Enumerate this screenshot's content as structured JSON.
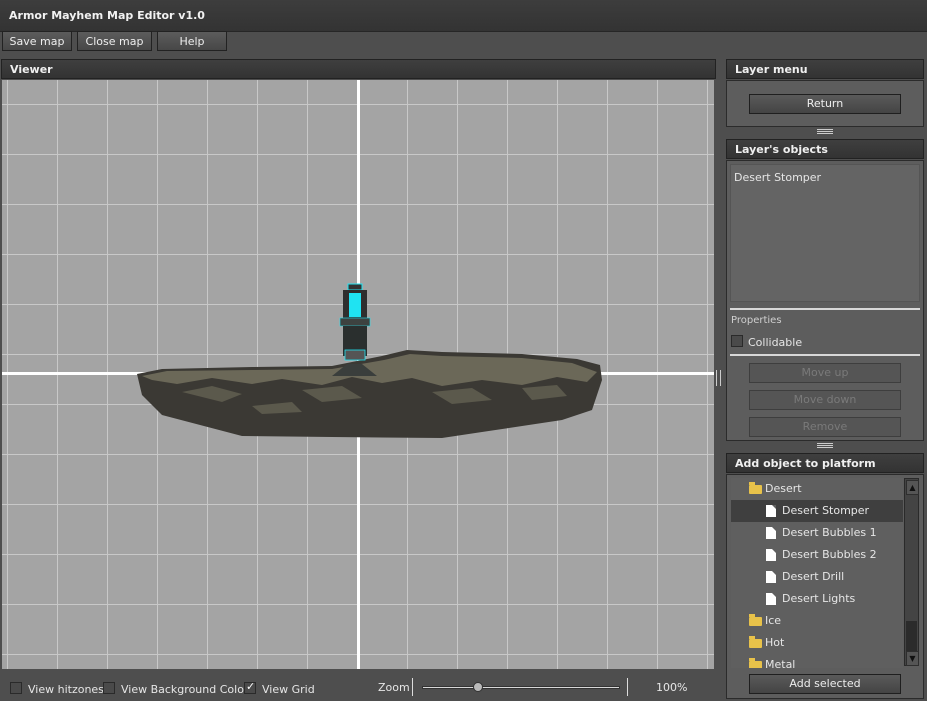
{
  "window": {
    "title": "Armor Mayhem Map Editor v1.0"
  },
  "toolbar": {
    "save_map": "Save map",
    "close_map": "Close map",
    "help": "Help"
  },
  "viewer": {
    "title": "Viewer"
  },
  "layer_menu": {
    "title": "Layer menu",
    "return_label": "Return"
  },
  "layer_objects": {
    "title": "Layer's objects",
    "items": [
      "Desert Stomper"
    ],
    "properties_label": "Properties",
    "collidable_label": "Collidable",
    "collidable_checked": false,
    "move_up_label": "Move up",
    "move_down_label": "Move down",
    "remove_label": "Remove"
  },
  "add_object": {
    "title": "Add object to platform",
    "tree": {
      "folders": [
        {
          "label": "Desert",
          "open": true
        },
        {
          "label": "Ice",
          "open": false
        },
        {
          "label": "Hot",
          "open": false
        },
        {
          "label": "Metal",
          "open": false
        }
      ],
      "desert_items": [
        "Desert Stomper",
        "Desert Bubbles 1",
        "Desert Bubbles 2",
        "Desert Drill",
        "Desert Lights"
      ],
      "selected": "Desert Stomper"
    },
    "add_selected_label": "Add selected"
  },
  "footer": {
    "view_hitzones": "View hitzones",
    "view_hitzones_checked": false,
    "view_background_color": "View Background Color",
    "view_background_color_checked": false,
    "view_grid": "View Grid",
    "view_grid_checked": true,
    "zoom_label": "Zoom",
    "zoom_value": "100%",
    "zoom_fraction": 0.29
  },
  "colors": {
    "accent_cyan": "#1fe3f2",
    "rock_dark": "#3b3934",
    "rock_light": "#6b6858"
  }
}
